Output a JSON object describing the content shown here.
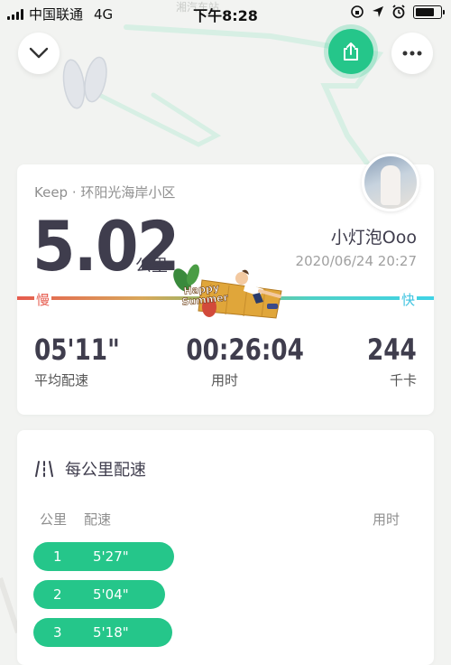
{
  "status_bar": {
    "carrier": "中国联通",
    "network": "4G",
    "time": "下午8:28"
  },
  "map": {
    "label": "湘汽车站"
  },
  "summary": {
    "location": "Keep · 环阳光海岸小区",
    "distance": "5.02",
    "distance_unit": "公里",
    "username": "小灯泡Ooo",
    "datetime": "2020/06/24 20:27",
    "slow_label": "慢",
    "fast_label": "快",
    "sticker_text_1": "Happy",
    "sticker_text_2": "Summer",
    "stats": [
      {
        "value": "05'11\"",
        "label": "平均配速"
      },
      {
        "value": "00:26:04",
        "label": "用时"
      },
      {
        "value": "244",
        "label": "千卡"
      }
    ]
  },
  "pace": {
    "title": "每公里配速",
    "headers": {
      "km": "公里",
      "pace": "配速",
      "time": "用时"
    },
    "rows": [
      {
        "km": "1",
        "pace": "5'27\"",
        "fill": 0.65
      },
      {
        "km": "2",
        "pace": "5'04\"",
        "fill": 0.61
      },
      {
        "km": "3",
        "pace": "5'18\"",
        "fill": 0.64
      }
    ]
  },
  "colors": {
    "accent": "#25c68a",
    "text_dark": "#3f3d4d",
    "slow": "#e65b4e",
    "fast": "#3fc3e0"
  }
}
